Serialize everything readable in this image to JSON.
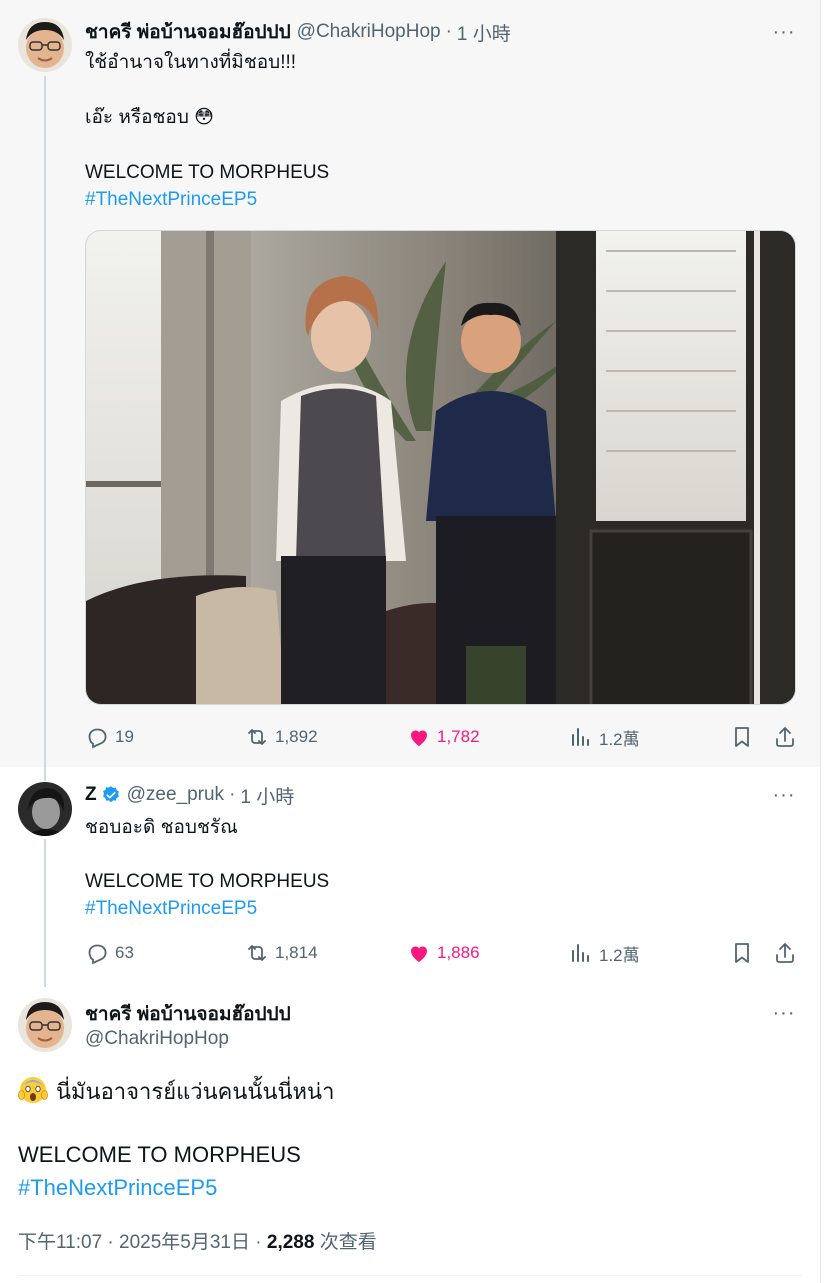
{
  "tweet1": {
    "display_name": "ชาครี พ่อบ้านจอมฮ๊อปปป",
    "handle": "@ChakriHopHop",
    "dot": "·",
    "time": "1 小時",
    "more": "···",
    "lines": [
      "ใช้อำนาจในทางที่มิชอบ!!!",
      "เอ๊ะ หรือชอบ 😳",
      "WELCOME TO MORPHEUS"
    ],
    "hashtag": "#TheNextPrinceEP5",
    "stats": {
      "replies": "19",
      "retweets": "1,892",
      "likes": "1,782",
      "views": "1.2萬"
    },
    "liked": true
  },
  "tweet2": {
    "display_name": "Z",
    "handle": "@zee_pruk",
    "dot": "·",
    "time": "1 小時",
    "more": "···",
    "lines": [
      "ชอบอะดิ ชอบชรัณ",
      "WELCOME TO MORPHEUS"
    ],
    "hashtag": "#TheNextPrinceEP5",
    "stats": {
      "replies": "63",
      "retweets": "1,814",
      "likes": "1,886",
      "views": "1.2萬"
    },
    "liked": true
  },
  "tweet3": {
    "display_name": "ชาครี พ่อบ้านจอมฮ๊อปปป",
    "handle": "@ChakriHopHop",
    "more": "···",
    "line1": "นี่มันอาจารย์แว่นคนนั้นนี่หน่า",
    "line2": "WELCOME TO MORPHEUS",
    "hashtag": "#TheNextPrinceEP5",
    "meta_time": "下午11:07 · 2025年5月31日 · ",
    "meta_views": "2,288",
    "meta_views_label": " 次查看"
  },
  "colors": {
    "accent": "#1d9bf0",
    "like": "#f91880",
    "secondary_text": "#536471",
    "verified": "#1d9bf0"
  },
  "icons": [
    "reply-icon",
    "retweet-icon",
    "like-icon",
    "views-icon",
    "bookmark-icon",
    "share-icon",
    "verified-badge-icon",
    "more-icon",
    "scream-emoji-icon"
  ]
}
